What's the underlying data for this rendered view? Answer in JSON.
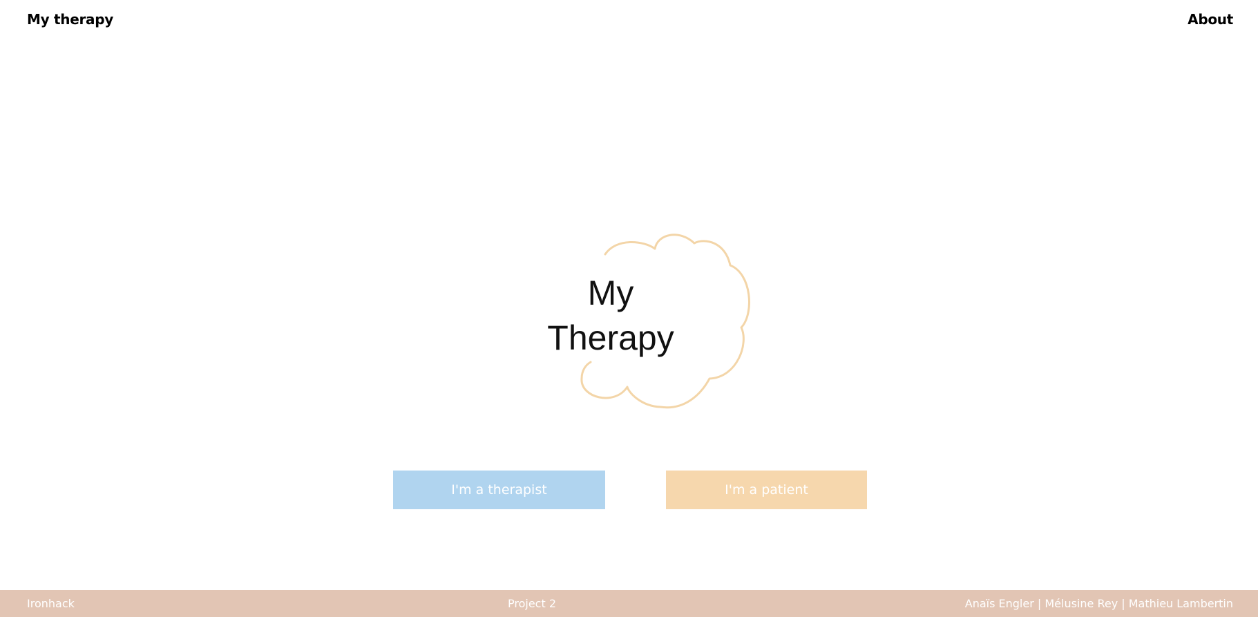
{
  "nav": {
    "brand": "My therapy",
    "about": "About"
  },
  "logo": {
    "line1": "My",
    "line2": "Therapy",
    "cloud_color": "#f3d5a8"
  },
  "buttons": {
    "therapist": "I'm a therapist",
    "patient": "I'm a patient",
    "therapist_color": "#b0d4ef",
    "patient_color": "#f6d7ad"
  },
  "footer": {
    "left": "Ironhack",
    "center": "Project 2",
    "right": "Anaïs Engler | Mélusine Rey | Mathieu Lambertin",
    "background": "#e2c5b4"
  }
}
